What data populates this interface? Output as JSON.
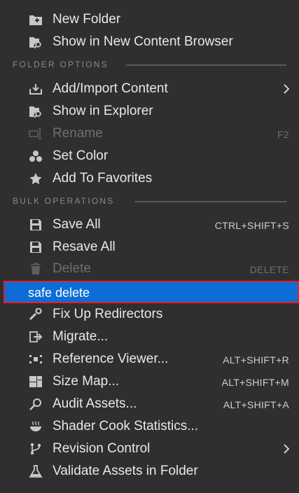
{
  "menu": {
    "items_top": [
      {
        "label": "New Folder",
        "icon": "new-folder-icon"
      },
      {
        "label": "Show in New Content Browser",
        "icon": "folder-search-icon"
      }
    ],
    "section_folder": "FOLDER OPTIONS",
    "folder_items": [
      {
        "label": "Add/Import Content",
        "icon": "import-icon",
        "submenu": true
      },
      {
        "label": "Show in Explorer",
        "icon": "folder-search-icon"
      },
      {
        "label": "Rename",
        "icon": "rename-icon",
        "shortcut": "F2",
        "disabled": true
      },
      {
        "label": "Set Color",
        "icon": "color-icon"
      },
      {
        "label": "Add To Favorites",
        "icon": "star-icon"
      }
    ],
    "section_bulk": "BULK OPERATIONS",
    "bulk_items": [
      {
        "label": "Save All",
        "icon": "save-icon",
        "shortcut": "CTRL+SHIFT+S"
      },
      {
        "label": "Resave All",
        "icon": "save-icon"
      },
      {
        "label": "Delete",
        "icon": "trash-icon",
        "shortcut": "DELETE",
        "disabled": true
      }
    ],
    "highlighted": {
      "label": "safe delete"
    },
    "tool_items": [
      {
        "label": "Fix Up Redirectors",
        "icon": "wrench-icon"
      },
      {
        "label": "Migrate...",
        "icon": "migrate-icon"
      },
      {
        "label": "Reference Viewer...",
        "icon": "reference-viewer-icon",
        "shortcut": "ALT+SHIFT+R"
      },
      {
        "label": "Size Map...",
        "icon": "size-map-icon",
        "shortcut": "ALT+SHIFT+M"
      },
      {
        "label": "Audit Assets...",
        "icon": "audit-icon",
        "shortcut": "ALT+SHIFT+A"
      },
      {
        "label": "Shader Cook Statistics...",
        "icon": "shader-icon"
      },
      {
        "label": "Revision Control",
        "icon": "branch-icon",
        "submenu": true
      },
      {
        "label": "Validate Assets in Folder",
        "icon": "flask-icon"
      }
    ]
  },
  "colors": {
    "background": "#2f2f2f",
    "highlight": "#0d6cd6",
    "highlight_border": "#e1222f"
  }
}
